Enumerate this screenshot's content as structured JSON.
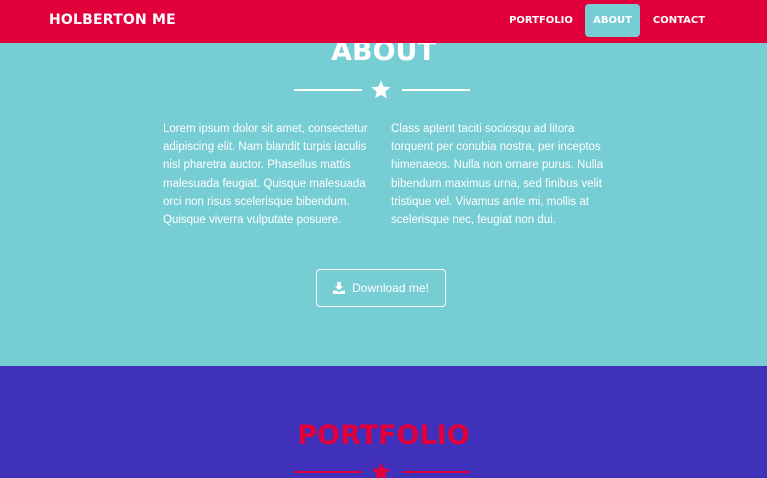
{
  "colors": {
    "navbar_bg": "#e2003c",
    "nav_active_bg": "#77cdd4",
    "about_bg": "#77cdd4",
    "portfolio_bg": "#3f31b9",
    "portfolio_accent": "#e2003c",
    "white": "#ffffff"
  },
  "navbar": {
    "brand": "HOLBERTON ME",
    "links": [
      {
        "label": "PORTFOLIO",
        "active": false
      },
      {
        "label": "ABOUT",
        "active": true
      },
      {
        "label": "CONTACT",
        "active": false
      }
    ]
  },
  "about": {
    "title": "ABOUT",
    "divider_icon": "star-icon",
    "paragraph_left": "Lorem ipsum dolor sit amet, consectetur adipiscing elit. Nam blandit turpis iaculis nisl pharetra auctor. Phasellus mattis malesuada feugiat. Quisque malesuada orci non risus scelerisque bibendum. Quisque viverra vulputate posuere.",
    "paragraph_right": "Class aptent taciti sociosqu ad litora torquent per conubia nostra, per inceptos himenaeos. Nulla non ornare purus. Nulla bibendum maximus urna, sed finibus velit tristique vel. Vivamus ante mi, mollis at scelerisque nec, feugiat non dui.",
    "download_button": {
      "label": "Download me!",
      "icon": "download-icon"
    }
  },
  "portfolio": {
    "title": "PORTFOLIO",
    "divider_icon": "star-icon"
  }
}
